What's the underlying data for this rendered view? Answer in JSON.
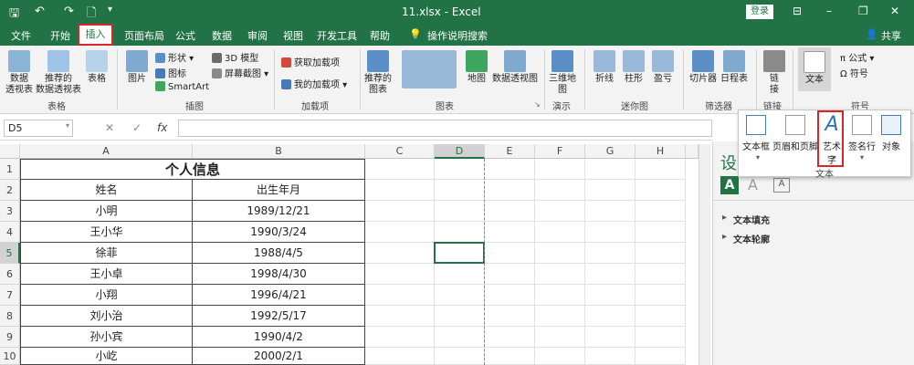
{
  "titlebar": {
    "title": "11.xlsx - Excel",
    "login": "登录",
    "save_icon": "save-icon",
    "undo_icon": "undo-icon",
    "redo_icon": "redo-icon",
    "new_icon": "new-doc-icon",
    "minimize": "–",
    "restore": "❐",
    "close": "✕",
    "ribbon_opt": "⊟"
  },
  "menu": {
    "tabs": [
      "文件",
      "开始",
      "插入",
      "页面布局",
      "公式",
      "数据",
      "审阅",
      "视图",
      "开发工具",
      "帮助"
    ],
    "search": "操作说明搜索",
    "share": "共享"
  },
  "ribbon": {
    "tables": {
      "pivot": "数据\n透视表",
      "rec_pivot": "推荐的\n数据透视表",
      "table": "表格",
      "label": "表格"
    },
    "illus": {
      "picture": "图片",
      "shapes": "形状",
      "icons": "图标",
      "smartart": "SmartArt",
      "model3d": "3D 模型",
      "screenshot": "屏幕截图",
      "label": "插图"
    },
    "addins": {
      "get": "获取加载项",
      "mine": "我的加载项",
      "label": "加载项"
    },
    "charts": {
      "rec": "推荐的\n图表",
      "map": "地图",
      "pivotchart": "数据透视图",
      "label": "图表"
    },
    "tours": {
      "map3d": "三维地\n图",
      "label": "演示"
    },
    "spark": {
      "line": "折线",
      "column": "柱形",
      "winloss": "盈亏",
      "label": "迷你图"
    },
    "filters": {
      "slicer": "切片器",
      "timeline": "日程表",
      "label": "筛选器"
    },
    "links": {
      "link": "链\n接",
      "label": "链接"
    },
    "text": {
      "text": "文本",
      "label": "文本"
    },
    "symbols": {
      "equation": "公式",
      "symbol": "符号",
      "label": "符号"
    }
  },
  "popup": {
    "textbox": "文本框",
    "header": "页眉和页脚",
    "wordart": "艺术字",
    "signature": "签名行",
    "object": "对象",
    "label": "文本"
  },
  "formula": {
    "cellref": "D5",
    "fx": "fx",
    "cancel": "✕",
    "enter": "✓"
  },
  "columns": [
    "A",
    "B",
    "C",
    "D",
    "E",
    "F",
    "G",
    "H"
  ],
  "rows": [
    "1",
    "2",
    "3",
    "4",
    "5",
    "6",
    "7",
    "8",
    "9",
    "10"
  ],
  "table": {
    "title": "个人信息",
    "headers": [
      "姓名",
      "出生年月"
    ],
    "data": [
      [
        "小明",
        "1989/12/21"
      ],
      [
        "王小华",
        "1990/3/24"
      ],
      [
        "徐菲",
        "1988/4/5"
      ],
      [
        "王小卓",
        "1998/4/30"
      ],
      [
        "小翔",
        "1996/4/21"
      ],
      [
        "刘小治",
        "1992/5/17"
      ],
      [
        "孙小宾",
        "1990/4/2"
      ],
      [
        "小屹",
        "2000/2/1"
      ]
    ]
  },
  "taskpane": {
    "title": "设",
    "fill": "文本填充",
    "outline": "文本轮廓"
  },
  "colors": {
    "brand": "#217346",
    "highlight": "#d9262b"
  }
}
